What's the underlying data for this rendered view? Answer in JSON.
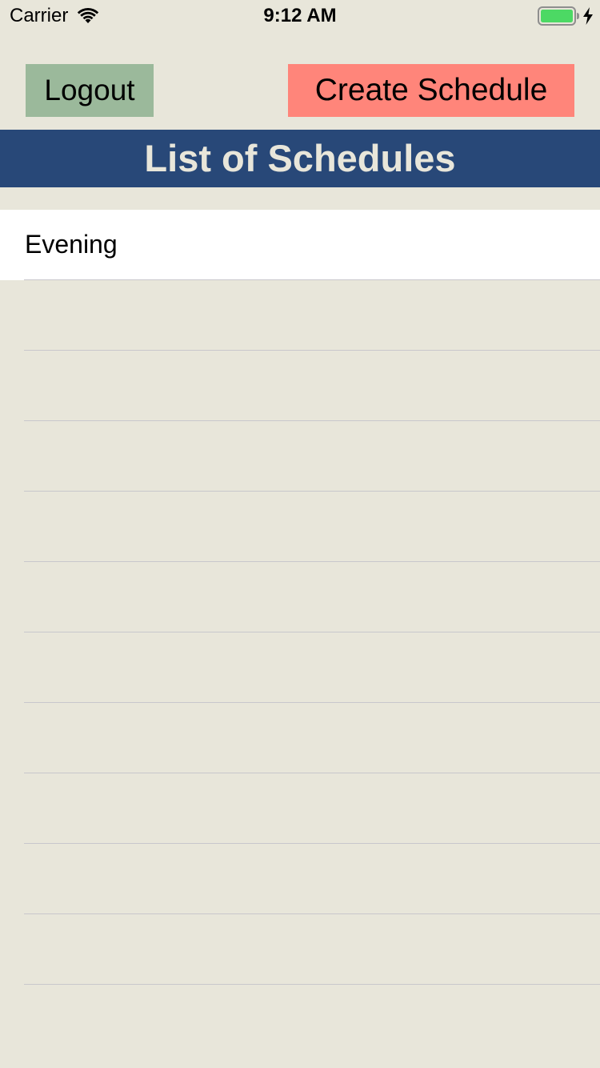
{
  "status_bar": {
    "carrier": "Carrier",
    "time": "9:12 AM",
    "battery_color": "#4cd964"
  },
  "toolbar": {
    "logout_label": "Logout",
    "create_label": "Create Schedule",
    "logout_color": "#9bb99b",
    "create_color": "#ff857a"
  },
  "header": {
    "title": "List of Schedules",
    "background": "#284878"
  },
  "schedules": [
    {
      "name": "Evening"
    }
  ],
  "empty_rows": 10,
  "colors": {
    "background": "#e8e6da",
    "separator": "#c8c7cc"
  }
}
